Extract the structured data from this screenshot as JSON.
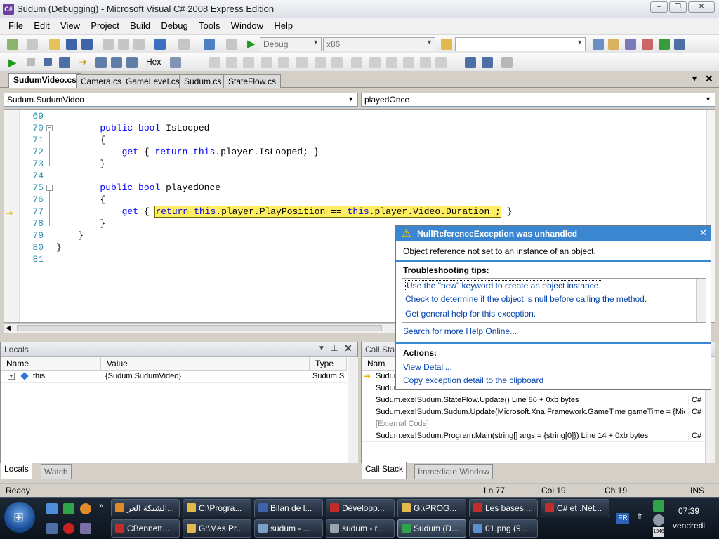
{
  "window": {
    "title": "Sudum (Debugging) - Microsoft Visual C# 2008 Express Edition"
  },
  "menu": [
    "File",
    "Edit",
    "View",
    "Project",
    "Build",
    "Debug",
    "Tools",
    "Window",
    "Help"
  ],
  "toolbar": {
    "config": "Debug",
    "platform": "x86",
    "hex_label": "Hex"
  },
  "tabs": [
    "SudumVideo.cs",
    "Camera.cs",
    "GameLevel.cs",
    "Sudum.cs",
    "StateFlow.cs"
  ],
  "nav": {
    "class": "Sudum.SudumVideo",
    "member": "playedOnce"
  },
  "code": {
    "lines": [
      {
        "n": "69",
        "text": ""
      },
      {
        "n": "70",
        "text": "        public bool IsLooped"
      },
      {
        "n": "71",
        "text": "        {"
      },
      {
        "n": "72",
        "text": "            get { return this.player.IsLooped; }"
      },
      {
        "n": "73",
        "text": "        }"
      },
      {
        "n": "74",
        "text": ""
      },
      {
        "n": "75",
        "text": "        public bool playedOnce"
      },
      {
        "n": "76",
        "text": "        {"
      },
      {
        "n": "77",
        "prefix": "            get { ",
        "highlight": "return this.player.PlayPosition == this.player.Video.Duration ;",
        "suffix": " }"
      },
      {
        "n": "78",
        "text": "        }"
      },
      {
        "n": "79",
        "text": "    }"
      },
      {
        "n": "80",
        "text": "}"
      },
      {
        "n": "81",
        "text": ""
      }
    ]
  },
  "exception": {
    "title": "NullReferenceException was unhandled",
    "message": "Object reference not set to an instance of an object.",
    "tips_heading": "Troubleshooting tips:",
    "tips": [
      "Use the \"new\" keyword to create an object instance.",
      "Check to determine if the object is null before calling the method.",
      "Get general help for this exception."
    ],
    "search": "Search for more Help Online...",
    "actions_heading": "Actions:",
    "actions": [
      "View Detail...",
      "Copy exception detail to the clipboard"
    ]
  },
  "locals": {
    "title": "Locals",
    "headers": [
      "Name",
      "Value",
      "Type"
    ],
    "rows": [
      {
        "name": "this",
        "value": "{Sudum.SudumVideo}",
        "type": "Sudum.Su"
      }
    ]
  },
  "callstack": {
    "title": "Call Stack",
    "header": "Nam",
    "rows": [
      {
        "text": "Sudum",
        "lang": ""
      },
      {
        "text": "Sudum",
        "lang": ""
      },
      {
        "text": "Sudum.exe!Sudum.StateFlow.Update() Line 86 + 0xb bytes",
        "lang": "C#"
      },
      {
        "text": "Sudum.exe!Sudum.Sudum.Update(Microsoft.Xna.Framework.GameTime gameTime = {Micro",
        "lang": "C#"
      },
      {
        "text": "[External Code]",
        "lang": ""
      },
      {
        "text": "Sudum.exe!Sudum.Program.Main(string[] args = {string[0]}) Line 14 + 0xb bytes",
        "lang": "C#"
      }
    ]
  },
  "bottom_tabs": {
    "locals": "Locals",
    "watch": "Watch",
    "callstack": "Call Stack",
    "immediate": "Immediate Window"
  },
  "status": {
    "ready": "Ready",
    "ln": "Ln 77",
    "col": "Col 19",
    "ch": "Ch 19",
    "ins": "INS"
  },
  "taskbar": {
    "row1": [
      "الشبكة العر...",
      "C:\\Progra...",
      "Bilan de l...",
      "Développ...",
      "G:\\PROG...",
      "Les bases....",
      "C# et .Net..."
    ],
    "row2": [
      "CBennett...",
      "G:\\Mes Pr...",
      "sudum - ...",
      "sudum - r...",
      "Sudum (D...",
      "01.png (9..."
    ],
    "lang": "FR",
    "time": "07:39",
    "day": "vendredi",
    "date_badge": "1346"
  }
}
